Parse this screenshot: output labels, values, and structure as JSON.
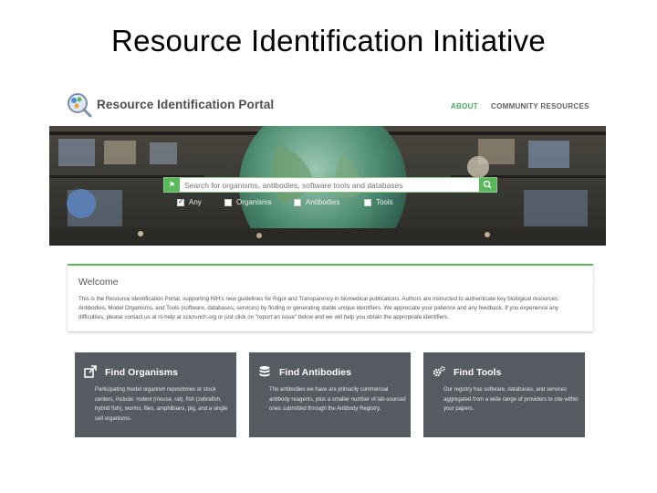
{
  "slide": {
    "title": "Resource Identification Initiative"
  },
  "nav": {
    "brand": "Resource Identification Portal",
    "about": "ABOUT",
    "community": "COMMUNITY RESOURCES"
  },
  "search": {
    "placeholder": "Search for organisms, antibodies, software tools and databases",
    "filters": [
      {
        "label": "Any",
        "checked": true
      },
      {
        "label": "Organisms",
        "checked": false
      },
      {
        "label": "Antibodies",
        "checked": false
      },
      {
        "label": "Tools",
        "checked": false
      }
    ]
  },
  "welcome": {
    "title": "Welcome",
    "body": "This is the Resource Identification Portal, supporting NIH's new guidelines for Rigor and Transparency in biomedical publications. Authors are instructed to authenticate key biological resources: Antibodies, Model Organisms, and Tools (software, databases, services) by finding or generating stable unique identifiers. We appreciate your patience and any feedback. If you experience any difficulties, please contact us at rii-help at scicrunch.org or just click on \"report an issue\" below and we will help you obtain the appropriate identifiers."
  },
  "cards": [
    {
      "icon": "external-link-icon",
      "title": "Find Organisms",
      "body": "Participating model organism repositories or stock centers, include: rodent (mouse, rat), fish (zebrafish, hybrid fish), worms, flies, amphibians, pig, and a single cell organisms."
    },
    {
      "icon": "database-icon",
      "title": "Find Antibodies",
      "body": "The antibodies we have are primarily commercial antibody reagents, plus a smaller number of lab-sourced ones submitted through the Antibody Registry."
    },
    {
      "icon": "gears-icon",
      "title": "Find Tools",
      "body": "Our registry has software, databases, and services aggregated from a wide range of providers to cite within your papers."
    }
  ],
  "colors": {
    "accent": "#5cb85c",
    "card_bg": "#575b62",
    "brand_text": "#4a4f55"
  }
}
